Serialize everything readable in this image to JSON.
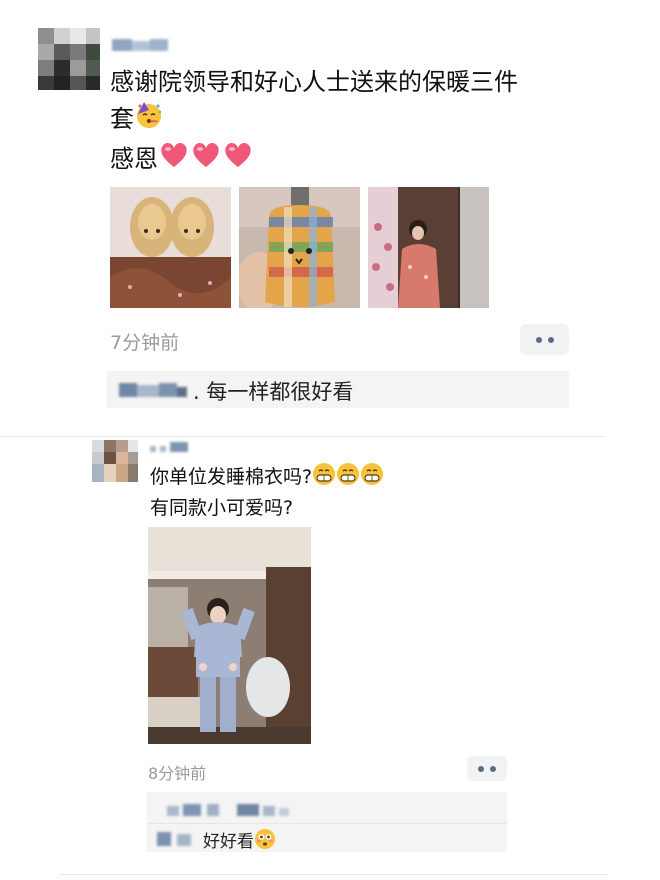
{
  "post1": {
    "text_lines": [
      "感谢院领导和好心人士送来的保暖三件",
      "套",
      "感恩"
    ],
    "timestamp": "7分钟前",
    "comment_text": ". 每一样都很好看",
    "emoji_partying": "partying-face-emoji",
    "emoji_heart": "heart-emoji"
  },
  "post2": {
    "text_lines": [
      "你单位发睡棉衣吗?",
      "有同款小可爱吗?"
    ],
    "timestamp": "8分钟前",
    "comment_text": "好好看",
    "emoji_grin": "grinning-face-emoji",
    "emoji_flushed": "flushed-face-emoji"
  },
  "colors": {
    "timestamp": "#9a9a9a",
    "more_dots": "#5a6b86",
    "comment_bg": "#f4f4f4",
    "heart": "#f0587a"
  }
}
